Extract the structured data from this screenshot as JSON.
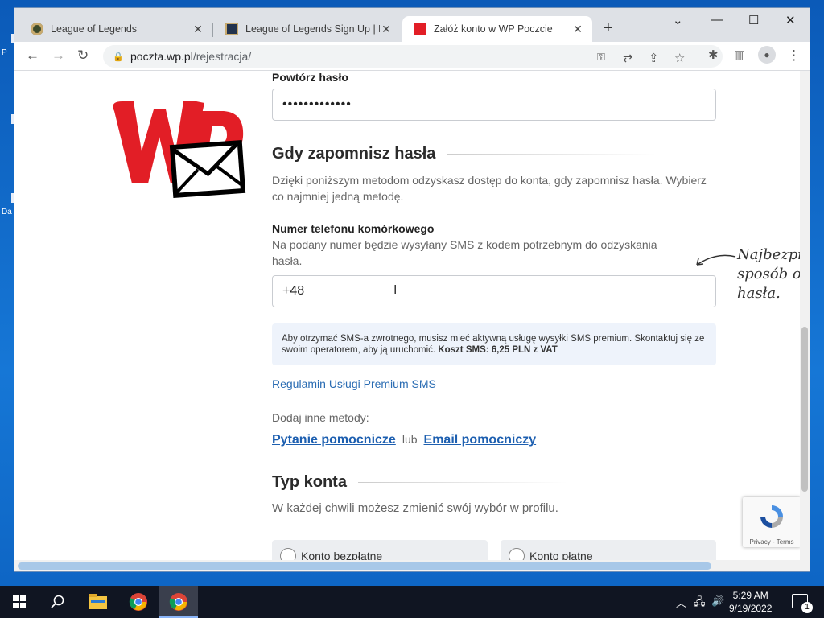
{
  "desktop": {
    "frag_p": "P",
    "frag_da": "Da"
  },
  "browser": {
    "tabs": [
      {
        "title": "League of Legends",
        "fav_color": "#3d4a2a"
      },
      {
        "title": "League of Legends Sign Up | Not",
        "fav_color": "#23334d"
      },
      {
        "title": "Załóż konto w WP Poczcie",
        "fav_color": "#e21e26"
      }
    ],
    "new_tab": "+",
    "window_controls": {
      "chevron": "⌄",
      "minimize": "—",
      "maximize": "☐",
      "close": "✕"
    },
    "nav": {
      "back": "←",
      "forward": "→",
      "reload": "↻"
    },
    "url": {
      "host": "poczta.wp.pl",
      "path": "/rejestracja/"
    },
    "toolbar_icons": {
      "key": "⚿",
      "translate": "⇄",
      "share": "⇪",
      "star": "☆",
      "extensions": "✱",
      "sidepanel": "▥",
      "profile": "●",
      "menu": "⋮"
    }
  },
  "page": {
    "repeat_password_label": "Powtórz hasło",
    "repeat_password_value": "•••••••••••••",
    "forgot_heading": "Gdy zapomnisz hasła",
    "forgot_desc": "Dzięki poniższym metodom odzyskasz dostęp do konta, gdy zapomnisz hasła. Wybierz co najmniej jedną metodę.",
    "phone_label": "Numer telefonu komórkowego",
    "phone_desc": "Na podany numer będzie wysyłany SMS z kodem potrzebnym do odzyskania hasła.",
    "phone_value": "+48",
    "sms_info": "Aby otrzymać SMS-a zwrotnego, musisz mieć aktywną usługę wysyłki SMS premium. Skontaktuj się ze swoim operatorem, aby ją uruchomić.",
    "sms_cost": "Koszt SMS: 6,25 PLN z VAT",
    "premium_link": "Regulamin Usługi Premium SMS",
    "add_methods": "Dodaj inne metody:",
    "question_link": "Pytanie pomocnicze",
    "or": "lub",
    "email_link": "Email pomocniczy",
    "account_type_heading": "Typ konta",
    "account_type_desc": "W każdej chwili możesz zmienić swój wybór w profilu.",
    "free_account": "Konto bezpłatne",
    "paid_account": "Konto płatne",
    "hand_note": [
      "Najbezpie",
      "sposób o",
      "hasła."
    ],
    "recaptcha": "Privacy - Terms"
  },
  "taskbar": {
    "time": "5:29 AM",
    "date": "9/19/2022",
    "notifications": "1"
  },
  "colors": {
    "wp_red": "#e21e26",
    "link": "#1d5fb0",
    "taskbar": "#101522"
  }
}
